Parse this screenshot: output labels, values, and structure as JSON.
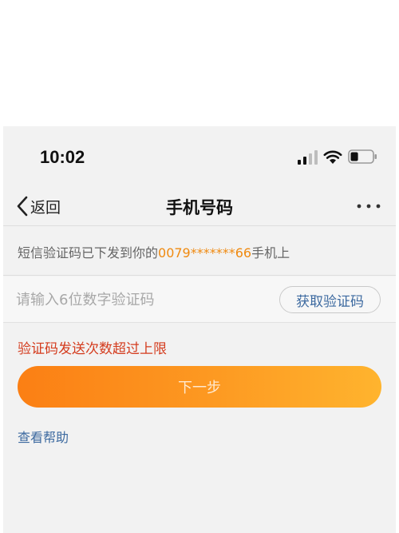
{
  "status_bar": {
    "time": "10:02",
    "signal_icon": "cellular-signal-icon",
    "wifi_icon": "wifi-icon",
    "battery_icon": "battery-icon",
    "battery_level": 0.35
  },
  "nav": {
    "back_label": "返回",
    "title": "手机号码",
    "back_icon": "chevron-left-icon",
    "more_icon": "more-dots-icon"
  },
  "info": {
    "prefix": "短信验证码已下发到你的",
    "phone": "0079*******66",
    "suffix": "手机上"
  },
  "code_input": {
    "value": "",
    "placeholder": "请输入6位数字验证码"
  },
  "get_code_label": "获取验证码",
  "error_message": "验证码发送次数超过上限",
  "next_label": "下一步",
  "help_label": "查看帮助",
  "colors": {
    "accent_orange": "#fb7f14",
    "link_blue": "#3d6aa0",
    "error_red": "#d43c1e",
    "phone_highlight": "#f08a10"
  }
}
